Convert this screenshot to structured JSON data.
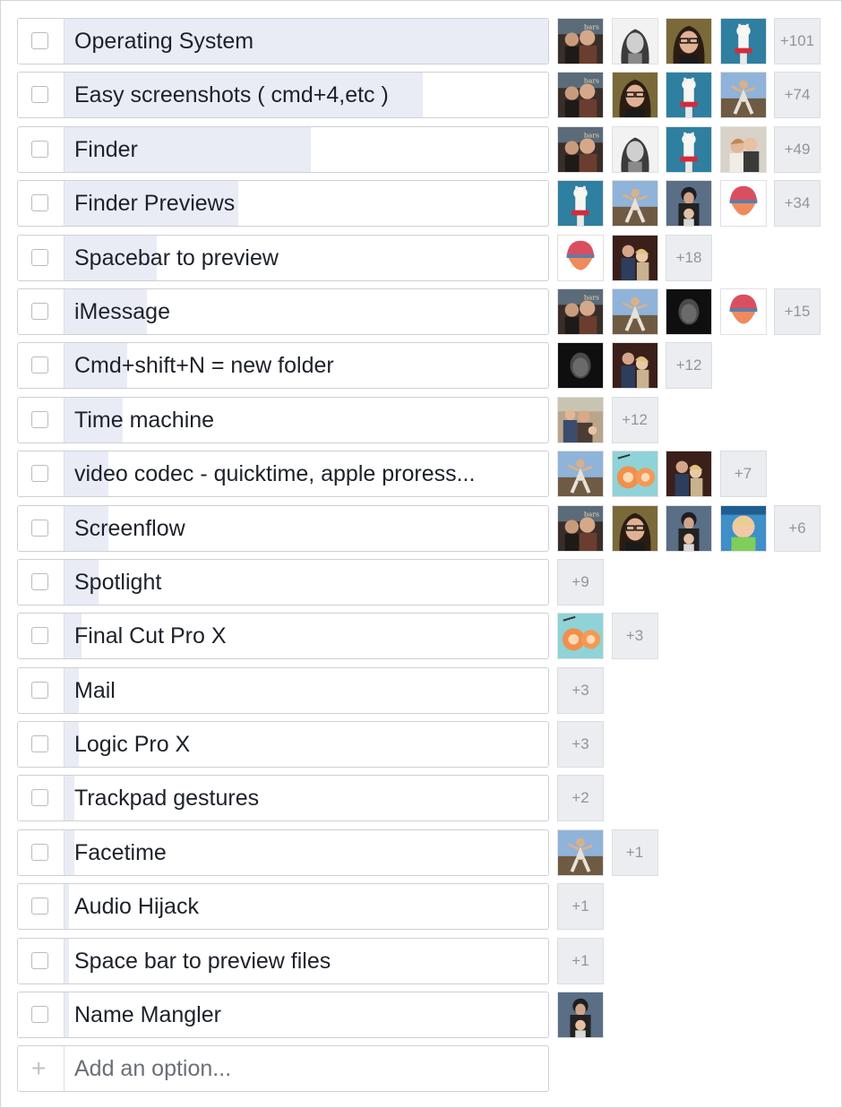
{
  "options": [
    {
      "label": "Operating System",
      "vote_share": 1.0,
      "voters": [
        "photo-group-selfie",
        "photo-woman-bw",
        "photo-woman-glasses",
        "photo-llama"
      ],
      "count": "+101"
    },
    {
      "label": "Easy screenshots ( cmd+4,etc )",
      "vote_share": 0.74,
      "voters": [
        "photo-group-selfie",
        "photo-woman-glasses",
        "photo-llama",
        "photo-dancer"
      ],
      "count": "+74"
    },
    {
      "label": "Finder",
      "vote_share": 0.51,
      "voters": [
        "photo-group-selfie",
        "photo-woman-bw",
        "photo-llama",
        "photo-couple"
      ],
      "count": "+49"
    },
    {
      "label": "Finder Previews",
      "vote_share": 0.36,
      "voters": [
        "photo-llama",
        "photo-dancer",
        "photo-father-child",
        "avatar-red-hat"
      ],
      "count": "+34"
    },
    {
      "label": "Spacebar to preview",
      "vote_share": 0.19,
      "voters": [
        "avatar-red-hat",
        "photo-man-woman"
      ],
      "count": "+18"
    },
    {
      "label": "iMessage",
      "vote_share": 0.17,
      "voters": [
        "photo-group-selfie",
        "photo-dancer",
        "photo-dark-portrait",
        "avatar-red-hat"
      ],
      "count": "+15"
    },
    {
      "label": "Cmd+shift+N = new folder",
      "vote_share": 0.13,
      "voters": [
        "photo-dark-portrait",
        "photo-man-woman"
      ],
      "count": "+12"
    },
    {
      "label": "Time machine",
      "vote_share": 0.12,
      "voters": [
        "photo-family"
      ],
      "count": "+12"
    },
    {
      "label": "video codec - quicktime, apple proress...",
      "vote_share": 0.09,
      "voters": [
        "photo-dancer",
        "avatar-cartoon-orange",
        "photo-man-woman"
      ],
      "count": "+7"
    },
    {
      "label": "Screenflow",
      "vote_share": 0.09,
      "voters": [
        "photo-group-selfie",
        "photo-woman-glasses",
        "photo-father-child",
        "photo-baby"
      ],
      "count": "+6"
    },
    {
      "label": "Spotlight",
      "vote_share": 0.07,
      "voters": [],
      "count": "+9"
    },
    {
      "label": "Final Cut Pro X",
      "vote_share": 0.035,
      "voters": [
        "avatar-cartoon-orange"
      ],
      "count": "+3"
    },
    {
      "label": "Mail",
      "vote_share": 0.03,
      "voters": [],
      "count": "+3"
    },
    {
      "label": "Logic Pro X",
      "vote_share": 0.03,
      "voters": [],
      "count": "+3"
    },
    {
      "label": "Trackpad gestures",
      "vote_share": 0.02,
      "voters": [],
      "count": "+2"
    },
    {
      "label": "Facetime",
      "vote_share": 0.02,
      "voters": [
        "photo-dancer"
      ],
      "count": "+1"
    },
    {
      "label": "Audio Hijack",
      "vote_share": 0.01,
      "voters": [],
      "count": "+1"
    },
    {
      "label": "Space bar to preview files",
      "vote_share": 0.01,
      "voters": [],
      "count": "+1"
    },
    {
      "label": "Name Mangler",
      "vote_share": 0.01,
      "voters": [
        "photo-father-child"
      ],
      "count": ""
    }
  ],
  "add_option": {
    "label": "Add an option..."
  },
  "colors": {
    "fill": "#e9ecf4",
    "border": "#ced0d4",
    "count_bg": "#ebedf0",
    "count_text": "#90949c",
    "text": "#1d2129"
  }
}
